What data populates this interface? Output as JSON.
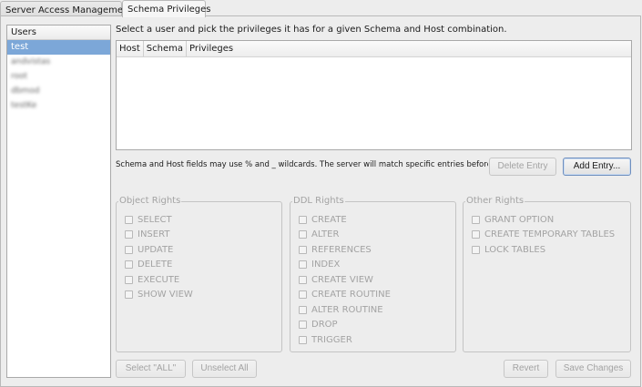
{
  "tabs": [
    {
      "label": "Server Access Management",
      "active": false
    },
    {
      "label": "Schema Privileges",
      "active": true
    }
  ],
  "users": {
    "header": "Users",
    "items": [
      "test",
      "andvistas",
      "root",
      "dbmod",
      "testKe"
    ]
  },
  "instruction": "Select a user and pick the privileges it has for a given Schema and Host combination.",
  "privileges_table": {
    "columns": [
      "Host",
      "Schema",
      "Privileges"
    ],
    "rows": []
  },
  "wildcard_note": "Schema and Host fields may use % and _ wildcards. The server will match specific entries before wildcarded ones.",
  "buttons": {
    "delete_entry": "Delete Entry",
    "add_entry": "Add Entry...",
    "select_all": "Select \"ALL\"",
    "unselect_all": "Unselect All",
    "revert": "Revert",
    "save_changes": "Save Changes"
  },
  "groups": {
    "object_rights": {
      "title": "Object Rights",
      "items": [
        "SELECT",
        "INSERT",
        "UPDATE",
        "DELETE",
        "EXECUTE",
        "SHOW VIEW"
      ]
    },
    "ddl_rights": {
      "title": "DDL Rights",
      "items": [
        "CREATE",
        "ALTER",
        "REFERENCES",
        "INDEX",
        "CREATE VIEW",
        "CREATE ROUTINE",
        "ALTER ROUTINE",
        "DROP",
        "TRIGGER"
      ]
    },
    "other_rights": {
      "title": "Other Rights",
      "items": [
        "GRANT OPTION",
        "CREATE TEMPORARY TABLES",
        "LOCK TABLES"
      ]
    }
  },
  "colors": {
    "selection": "#7ca7d8",
    "window_bg": "#ededed",
    "disabled_text": "#a3a3a3"
  }
}
